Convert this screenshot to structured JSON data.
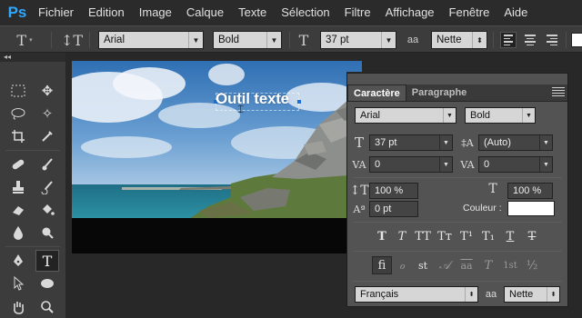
{
  "app": {
    "logo": "Ps"
  },
  "menu": [
    "Fichier",
    "Edition",
    "Image",
    "Calque",
    "Texte",
    "Sélection",
    "Filtre",
    "Affichage",
    "Fenêtre",
    "Aide"
  ],
  "options": {
    "font_family": "Arial",
    "font_style": "Bold",
    "font_size": "37 pt",
    "antialias_glyph": "aa",
    "antialias": "Nette"
  },
  "canvas": {
    "text": "Outil texte"
  },
  "panel": {
    "tabs": [
      "Caractère",
      "Paragraphe"
    ],
    "font_family": "Arial",
    "font_style": "Bold",
    "font_size": "37 pt",
    "leading": "(Auto)",
    "kerning": "0",
    "tracking": "0",
    "vertical_scale": "100 %",
    "horizontal_scale": "100 %",
    "baseline_shift": "0 pt",
    "color_label": "Couleur :",
    "color": "#ffffff",
    "style_buttons": [
      "T",
      "T",
      "TT",
      "Tт",
      "T¹",
      "T₁",
      "T",
      "T"
    ],
    "opentype_buttons": [
      "ﬁ",
      "ℴ",
      "st",
      "𝒜",
      "aa",
      "T",
      "1st",
      "½"
    ],
    "language": "Français",
    "antialias_glyph": "aa",
    "antialias": "Nette"
  }
}
